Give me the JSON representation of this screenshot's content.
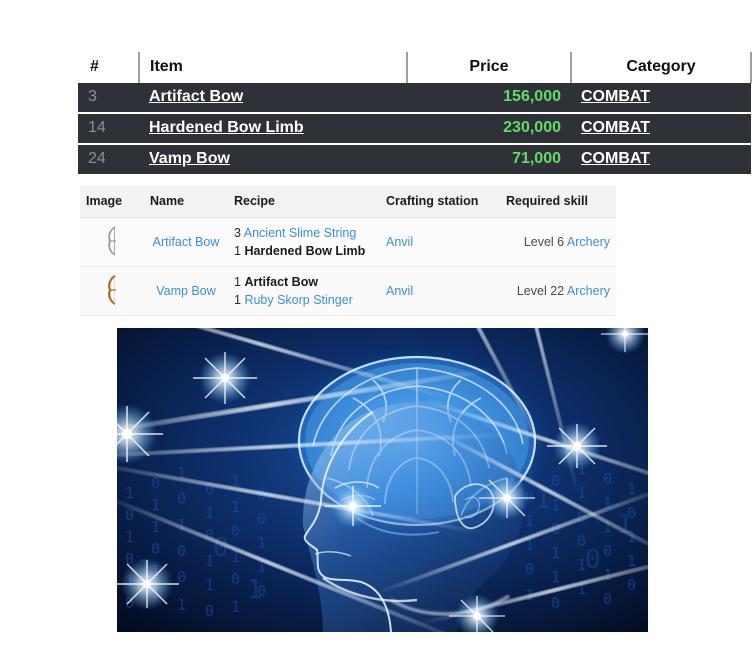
{
  "price_table": {
    "columns": [
      "#",
      "Item",
      "Price",
      "Category"
    ],
    "rows": [
      {
        "num": "3",
        "item": "Artifact Bow",
        "price": "156,000",
        "category": "COMBAT"
      },
      {
        "num": "14",
        "item": "Hardened Bow Limb",
        "price": "230,000",
        "category": "COMBAT"
      },
      {
        "num": "24",
        "item": "Vamp Bow",
        "price": "71,000",
        "category": "COMBAT"
      }
    ],
    "colors": {
      "row_background": "#2e3238",
      "num_background": "#3b4046",
      "price_text": "#5fdd63",
      "item_text": "#ffffff",
      "header_background": "#ffffff",
      "header_text": "#111111"
    }
  },
  "crafting_table": {
    "columns": [
      "Image",
      "Name",
      "Recipe",
      "Crafting station",
      "Required skill"
    ],
    "rows": [
      {
        "icon": "grey-bow-icon",
        "name": "Artifact Bow",
        "recipe": [
          {
            "qty": "3",
            "item": "Ancient Slime String",
            "style": "link"
          },
          {
            "qty": "1",
            "item": "Hardened Bow Limb",
            "style": "bold"
          }
        ],
        "station": "Anvil",
        "skill_level": "Level 6",
        "skill_name": "Archery"
      },
      {
        "icon": "orange-bow-icon",
        "name": "Vamp Bow",
        "recipe": [
          {
            "qty": "1",
            "item": "Artifact Bow",
            "style": "bold"
          },
          {
            "qty": "1",
            "item": "Ruby Skorp Stinger",
            "style": "link"
          }
        ],
        "station": "Anvil",
        "skill_level": "Level 22",
        "skill_name": "Archery"
      }
    ],
    "colors": {
      "header_background": "#f3f3f3",
      "link": "#3c8fd6",
      "text": "#4a4a4a"
    }
  },
  "figure": {
    "name": "glowing-blue-brain-head-image",
    "description": "Glowing blue translucent human head in profile with a luminous brain, light beams radiating outward and binary digits in the dark blue background",
    "colors": {
      "background": "#030a1c",
      "glow": "#4fb3ff",
      "beam": "#e8f6ff",
      "binary": "#1b4fa8"
    }
  }
}
